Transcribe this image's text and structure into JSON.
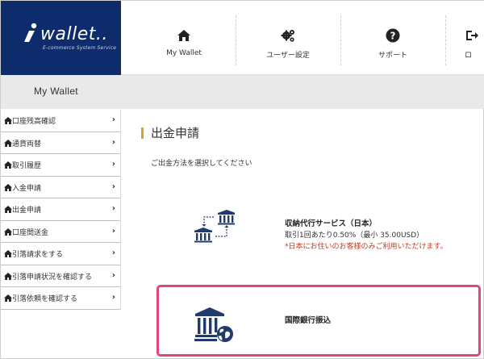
{
  "logo": {
    "name": "wallet..",
    "tagline": "E-commerce System Service"
  },
  "nav": {
    "items": [
      {
        "label": "My Wallet",
        "icon": "home-icon"
      },
      {
        "label": "ユーザー設定",
        "icon": "gears-icon"
      },
      {
        "label": "サポート",
        "icon": "question-icon"
      },
      {
        "label": "ロ",
        "icon": "logout-icon"
      }
    ]
  },
  "band": {
    "title": "My Wallet"
  },
  "sidebar": {
    "items": [
      {
        "label": "口座残高確認"
      },
      {
        "label": "通貨両替"
      },
      {
        "label": "取引履歴"
      },
      {
        "label": "入金申請"
      },
      {
        "label": "出金申請"
      },
      {
        "label": "口座間送金"
      },
      {
        "label": "引落請求をする"
      },
      {
        "label": "引落申請状況を確認する"
      },
      {
        "label": "引落依頼を確認する"
      }
    ]
  },
  "main": {
    "title": "出金申請",
    "subtitle": "ご出金方法を選択してください",
    "options": [
      {
        "name": "収納代行サービス（日本）",
        "fee": "取引1回あたり0.50%（最小 35.00USD）",
        "note": "*日本にお住いのお客様のみご利用いただけます。"
      },
      {
        "name": "国際銀行振込"
      }
    ]
  },
  "colors": {
    "brand_navy": "#0e2c6b",
    "title_accent": "#d6a22a",
    "highlight_border": "#e2457f",
    "note_red": "#c23b22",
    "icon_navy": "#1f3b6e"
  }
}
